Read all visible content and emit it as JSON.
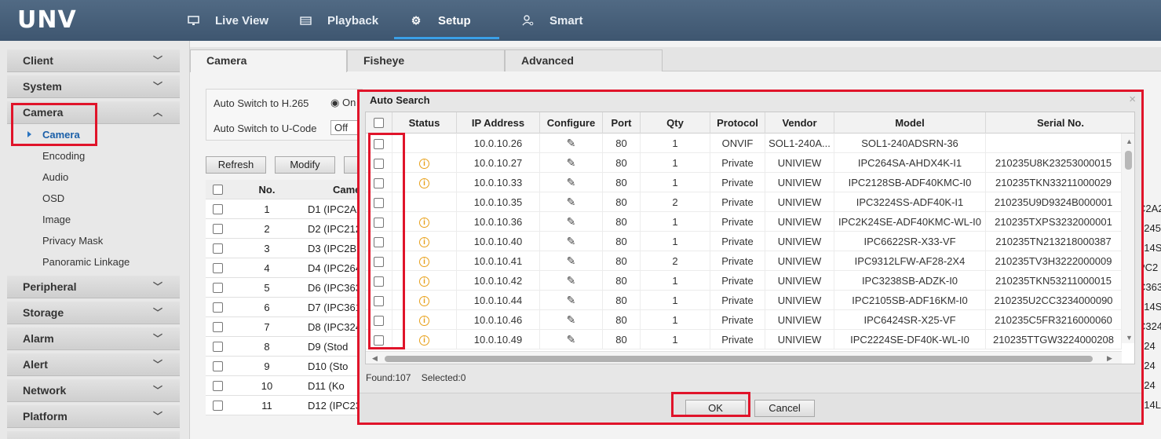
{
  "logo": "UNV",
  "nav": [
    {
      "label": "Live View",
      "icon": "monitor-icon"
    },
    {
      "label": "Playback",
      "icon": "film-icon"
    },
    {
      "label": "Setup",
      "icon": "gear-icon",
      "active": true
    },
    {
      "label": "Smart",
      "icon": "person-search-icon"
    }
  ],
  "sidebar": {
    "client": "Client",
    "system": "System",
    "camera": "Camera",
    "camera_items": [
      "Camera",
      "Encoding",
      "Audio",
      "OSD",
      "Image",
      "Privacy Mask",
      "Panoramic Linkage"
    ],
    "peripheral": "Peripheral",
    "storage": "Storage",
    "alarm": "Alarm",
    "alert": "Alert",
    "network": "Network",
    "platform": "Platform"
  },
  "tabs": [
    "Camera",
    "Fisheye",
    "Advanced"
  ],
  "settings": {
    "h265_label": "Auto Switch to H.265",
    "h265_value": "On",
    "ucode_label": "Auto Switch to U-Code",
    "ucode_value": "Off"
  },
  "toolbar": {
    "refresh": "Refresh",
    "modify": "Modify"
  },
  "bg_table": {
    "header_no": "No.",
    "header_camera": "Came",
    "rows": [
      {
        "no": "1",
        "name": "D1 (IPC2A2"
      },
      {
        "no": "2",
        "name": "D2 (IPC212"
      },
      {
        "no": "3",
        "name": "D3 (IPC2B1"
      },
      {
        "no": "4",
        "name": "D4 (IPC264"
      },
      {
        "no": "5",
        "name": "D6 (IPC363"
      },
      {
        "no": "6",
        "name": "D7 (IPC361"
      },
      {
        "no": "7",
        "name": "D8 (IPC324"
      },
      {
        "no": "8",
        "name": "D9 (Stod"
      },
      {
        "no": "9",
        "name": "D10 (Sto"
      },
      {
        "no": "10",
        "name": "D11 (Ko"
      },
      {
        "no": "11",
        "name": "D12 (IPC23"
      }
    ],
    "right_clip": [
      "C2A2",
      "1245",
      "314S",
      "PC2",
      "C363",
      "614S",
      "C324",
      "624",
      "624",
      "624",
      "314L"
    ]
  },
  "dialog": {
    "title": "Auto Search",
    "close": "×",
    "columns": [
      "Status",
      "IP Address",
      "Configure",
      "Port",
      "Qty",
      "Protocol",
      "Vendor",
      "Model",
      "Serial No."
    ],
    "rows": [
      {
        "warn": false,
        "ip": "10.0.10.26",
        "port": "80",
        "qty": "1",
        "protocol": "ONVIF",
        "vendor": "SOL1-240A...",
        "model": "SOL1-240ADSRN-36",
        "serial": ""
      },
      {
        "warn": true,
        "ip": "10.0.10.27",
        "port": "80",
        "qty": "1",
        "protocol": "Private",
        "vendor": "UNIVIEW",
        "model": "IPC264SA-AHDX4K-I1",
        "serial": "210235U8K23253000015"
      },
      {
        "warn": true,
        "ip": "10.0.10.33",
        "port": "80",
        "qty": "1",
        "protocol": "Private",
        "vendor": "UNIVIEW",
        "model": "IPC2128SB-ADF40KMC-I0",
        "serial": "210235TKN33211000029"
      },
      {
        "warn": false,
        "ip": "10.0.10.35",
        "port": "80",
        "qty": "2",
        "protocol": "Private",
        "vendor": "UNIVIEW",
        "model": "IPC3224SS-ADF40K-I1",
        "serial": "210235U9D9324B000001"
      },
      {
        "warn": true,
        "ip": "10.0.10.36",
        "port": "80",
        "qty": "1",
        "protocol": "Private",
        "vendor": "UNIVIEW",
        "model": "IPC2K24SE-ADF40KMC-WL-I0",
        "serial": "210235TXPS3232000001"
      },
      {
        "warn": true,
        "ip": "10.0.10.40",
        "port": "80",
        "qty": "1",
        "protocol": "Private",
        "vendor": "UNIVIEW",
        "model": "IPC6622SR-X33-VF",
        "serial": "210235TN213218000387"
      },
      {
        "warn": true,
        "ip": "10.0.10.41",
        "port": "80",
        "qty": "2",
        "protocol": "Private",
        "vendor": "UNIVIEW",
        "model": "IPC9312LFW-AF28-2X4",
        "serial": "210235TV3H3222000009"
      },
      {
        "warn": true,
        "ip": "10.0.10.42",
        "port": "80",
        "qty": "1",
        "protocol": "Private",
        "vendor": "UNIVIEW",
        "model": "IPC3238SB-ADZK-I0",
        "serial": "210235TKN53211000015"
      },
      {
        "warn": true,
        "ip": "10.0.10.44",
        "port": "80",
        "qty": "1",
        "protocol": "Private",
        "vendor": "UNIVIEW",
        "model": "IPC2105SB-ADF16KM-I0",
        "serial": "210235U2CC3234000090"
      },
      {
        "warn": true,
        "ip": "10.0.10.46",
        "port": "80",
        "qty": "1",
        "protocol": "Private",
        "vendor": "UNIVIEW",
        "model": "IPC6424SR-X25-VF",
        "serial": "210235C5FR3216000060"
      },
      {
        "warn": true,
        "ip": "10.0.10.49",
        "port": "80",
        "qty": "1",
        "protocol": "Private",
        "vendor": "UNIVIEW",
        "model": "IPC2224SE-DF40K-WL-I0",
        "serial": "210235TTGW3224000208"
      }
    ],
    "found": "Found:107",
    "selected": "Selected:0",
    "ok": "OK",
    "cancel": "Cancel"
  },
  "colors": {
    "highlight": "#e0142a",
    "topbar": "#4a627b",
    "accent": "#3aa0e8",
    "warning": "#e8a01a"
  }
}
